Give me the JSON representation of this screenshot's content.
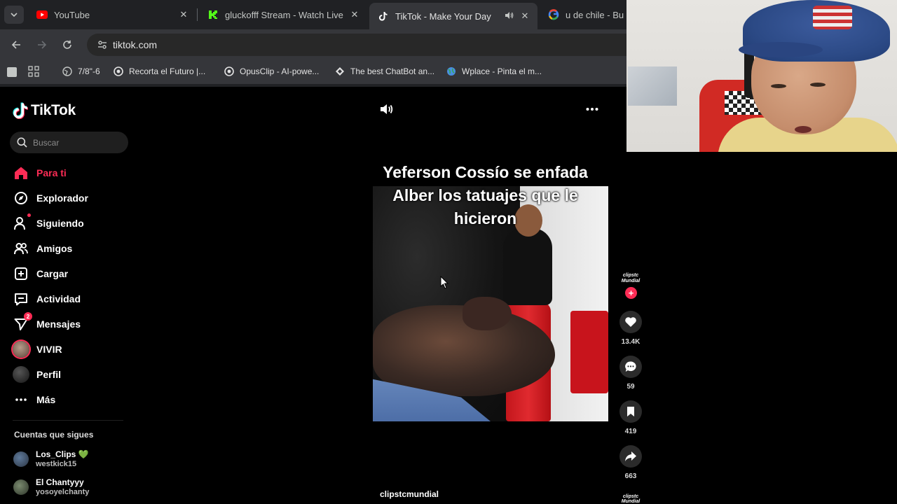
{
  "browser": {
    "tabs": [
      {
        "title": "YouTube",
        "favicon": "youtube-icon",
        "active": false
      },
      {
        "title": "gluckofff Stream - Watch Live o",
        "favicon": "kick-icon",
        "active": false
      },
      {
        "title": "TikTok - Make Your Day",
        "favicon": "tiktok-icon",
        "active": true
      },
      {
        "title": "u de chile - Busc",
        "favicon": "google-icon",
        "active": false
      }
    ],
    "url": "tiktok.com",
    "bookmarks": [
      {
        "label": "7/8\"-6",
        "icon": "globe-icon"
      },
      {
        "label": "Recorta el Futuro |...",
        "icon": "opus-icon"
      },
      {
        "label": "OpusClip - AI-powe...",
        "icon": "opus-icon"
      },
      {
        "label": "The best ChatBot an...",
        "icon": "diamond-icon"
      },
      {
        "label": "Wplace - Pinta el m...",
        "icon": "globe-icon"
      }
    ]
  },
  "tiktok": {
    "brand": "TikTok",
    "search_placeholder": "Buscar",
    "nav": [
      {
        "label": "Para ti",
        "icon": "home-icon",
        "active": true
      },
      {
        "label": "Explorador",
        "icon": "compass-icon"
      },
      {
        "label": "Siguiendo",
        "icon": "following-icon"
      },
      {
        "label": "Amigos",
        "icon": "friends-icon"
      },
      {
        "label": "Cargar",
        "icon": "upload-icon"
      },
      {
        "label": "Actividad",
        "icon": "activity-icon"
      },
      {
        "label": "Mensajes",
        "icon": "messages-icon",
        "badge": "2"
      },
      {
        "label": "VIVIR",
        "icon": "live-avatar"
      },
      {
        "label": "Perfil",
        "icon": "profile-avatar"
      },
      {
        "label": "Más",
        "icon": "more-icon"
      }
    ],
    "following_title": "Cuentas que sigues",
    "following": [
      {
        "name": "Los_Clips 💚",
        "handle": "westkick15"
      },
      {
        "name": "El Chantyyy",
        "handle": "yosoyelchanty"
      }
    ]
  },
  "video": {
    "caption": "Yeferson Cossío se enfada Alber los tatuajes que le hicieron",
    "author": "clipstcmundial",
    "creator_badge": "clipstc Mundial",
    "likes": "13.4K",
    "comments": "59",
    "saves": "419",
    "shares": "663"
  },
  "colors": {
    "accent": "#fe2c55",
    "chrome_bg": "#202124",
    "chrome_toolbar": "#35363a"
  }
}
